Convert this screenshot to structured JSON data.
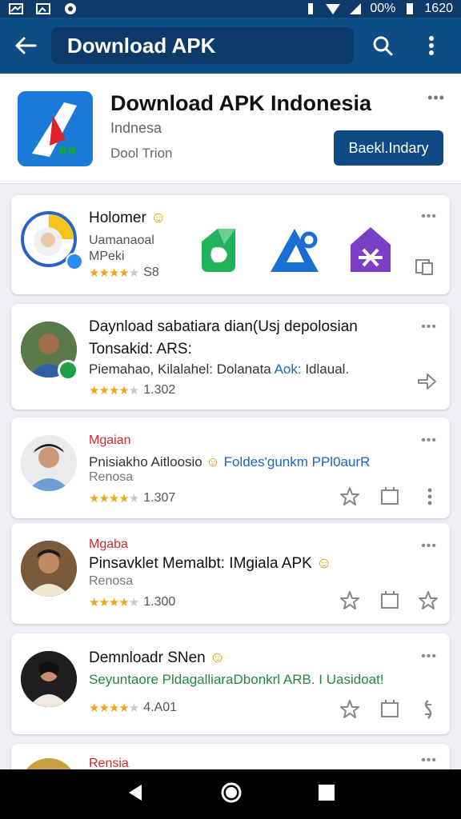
{
  "status": {
    "time": "1620",
    "battery": "00%"
  },
  "appbar": {
    "search_text": "Download APK"
  },
  "header": {
    "title": "Download APK Indonesia",
    "subtitle": "Indnesa",
    "meta": "Dool Trion",
    "button": "Baekl.Indary"
  },
  "cards": [
    {
      "title": "Holomer",
      "line1": "Uamanaoal",
      "line2": "MPeki",
      "stars": 4,
      "count": "S8"
    },
    {
      "title1": "Daynload sabatiara dian(Usj depolosian",
      "title2": "Tonsakid: ARS:",
      "line_a": "Piemahao, Kilalahel: Dolanata",
      "line_b": "Aok:",
      "line_c": "Idlaual.",
      "stars": 4,
      "count": "1.302"
    },
    {
      "tag": "Mgaian",
      "line_a": "Pnisiakho Aitloosio",
      "line_b": "Foldes'gunkm PPl0aurR",
      "grey": "Renosa",
      "stars": 4,
      "count": "1.307"
    },
    {
      "tag": "Mgaba",
      "line": "Pinsavklet Memalbt: IMgiala APK",
      "grey": "Renosa",
      "stars": 4,
      "count": "1.300"
    },
    {
      "title": "Demnloadr SNen",
      "line": "Seyuntaore PldagalliaraDbonkrl ARB. I Uasidoat!",
      "stars": 4,
      "count": "4.A01"
    },
    {
      "tag": "Rensia"
    }
  ],
  "colors": {
    "appbar": "#0f4d86",
    "accent": "#0d4a86",
    "star": "#f0a51c"
  }
}
